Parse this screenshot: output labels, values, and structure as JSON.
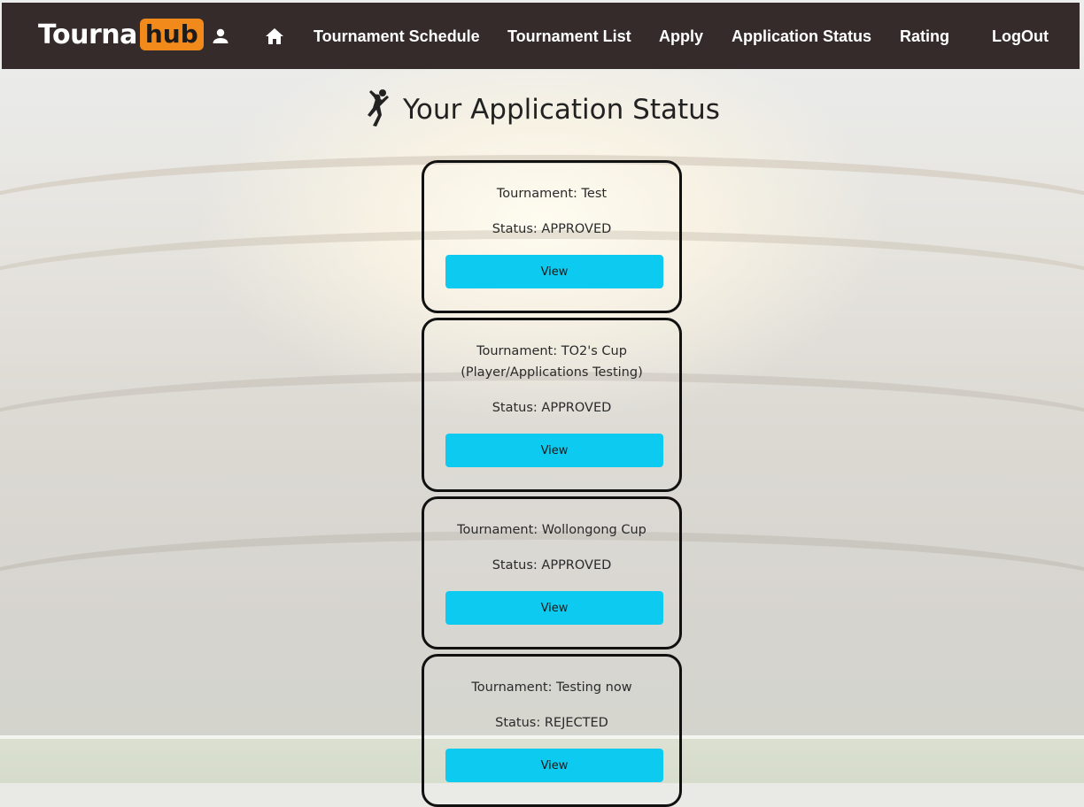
{
  "nav": {
    "brand_main": "Tourna",
    "brand_accent": "hub",
    "links": [
      "Tournament Schedule",
      "Tournament List",
      "Apply",
      "Application Status",
      "Rating",
      "LogOut"
    ]
  },
  "page": {
    "title": "Your Application Status"
  },
  "applications": [
    {
      "tournament": "Tournament: Test",
      "tournament_line2": "",
      "status": "Status: APPROVED",
      "button": "View"
    },
    {
      "tournament": "Tournament: TO2's Cup",
      "tournament_line2": "(Player/Applications Testing)",
      "status": "Status: APPROVED",
      "button": "View"
    },
    {
      "tournament": "Tournament: Wollongong Cup",
      "tournament_line2": "",
      "status": "Status: APPROVED",
      "button": "View"
    },
    {
      "tournament": "Tournament: Testing now",
      "tournament_line2": "",
      "status": "Status: REJECTED",
      "button": "View"
    }
  ],
  "colors": {
    "navbar": "#352b2b",
    "brand_accent": "#f28a1b",
    "button": "#0dcaf0"
  },
  "icons": {
    "nav": [
      "user-icon",
      "home-icon"
    ],
    "title": "handball-player-icon"
  }
}
